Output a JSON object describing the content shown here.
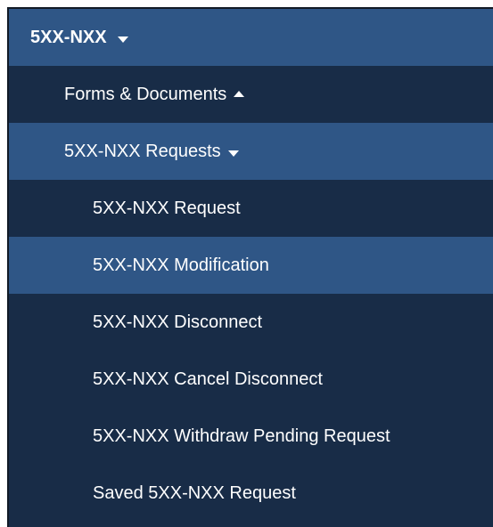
{
  "menu": {
    "header": {
      "label": "5XX-NXX",
      "icon": "chevron-down-icon"
    },
    "forms": {
      "label": "Forms & Documents",
      "icon": "chevron-up-icon"
    },
    "requests": {
      "label": "5XX-NXX Requests",
      "icon": "chevron-down-icon",
      "items": [
        {
          "label": "5XX-NXX Request"
        },
        {
          "label": "5XX-NXX Modification"
        },
        {
          "label": "5XX-NXX Disconnect"
        },
        {
          "label": "5XX-NXX Cancel Disconnect"
        },
        {
          "label": "5XX-NXX Withdraw Pending Request"
        },
        {
          "label": "Saved 5XX-NXX Request"
        }
      ]
    }
  },
  "colors": {
    "nav_dark": "#182c47",
    "nav_highlight": "#2f5686",
    "text": "#ffffff"
  }
}
